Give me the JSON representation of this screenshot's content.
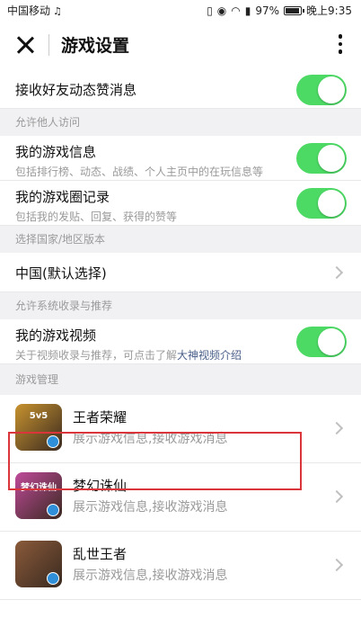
{
  "status_bar": {
    "carrier": "中国移动",
    "battery": "97%",
    "battery_level": 0.97,
    "time": "晚上9:35"
  },
  "nav": {
    "title": "游戏设置"
  },
  "rows": {
    "friend_likes": {
      "label": "接收好友动态赞消息",
      "on": true
    },
    "section_visits": "允许他人访问",
    "game_info": {
      "label": "我的游戏信息",
      "desc": "包括排行榜、动态、战绩、个人主页中的在玩信息等",
      "on": true
    },
    "game_circle": {
      "label": "我的游戏圈记录",
      "desc": "包括我的发贴、回复、获得的赞等",
      "on": true
    },
    "section_region": "选择国家/地区版本",
    "region": {
      "label": "中国(默认选择)"
    },
    "section_recommend": "允许系统收录与推荐",
    "game_video": {
      "label": "我的游戏视频",
      "desc_prefix": "关于视频收录与推荐，可点击了解",
      "desc_link": "大神视频介绍",
      "on": true
    },
    "section_manage": "游戏管理"
  },
  "games": [
    {
      "name": "王者荣耀",
      "desc": "展示游戏信息,接收游戏消息",
      "icon": "game-icon-wangzhe",
      "icon_text": "5v5",
      "color": "#c8932f"
    },
    {
      "name": "梦幻诛仙",
      "desc": "展示游戏信息,接收游戏消息",
      "icon": "game-icon-menghuan",
      "icon_text": "梦幻诛仙",
      "color": "#c04a9a"
    },
    {
      "name": "乱世王者",
      "desc": "展示游戏信息,接收游戏消息",
      "icon": "game-icon-luanshi",
      "icon_text": "",
      "color": "#8a5a3a"
    }
  ],
  "colors": {
    "toggle_on": "#4cd964",
    "highlight": "#d9353a",
    "link": "#4a5f8a"
  }
}
